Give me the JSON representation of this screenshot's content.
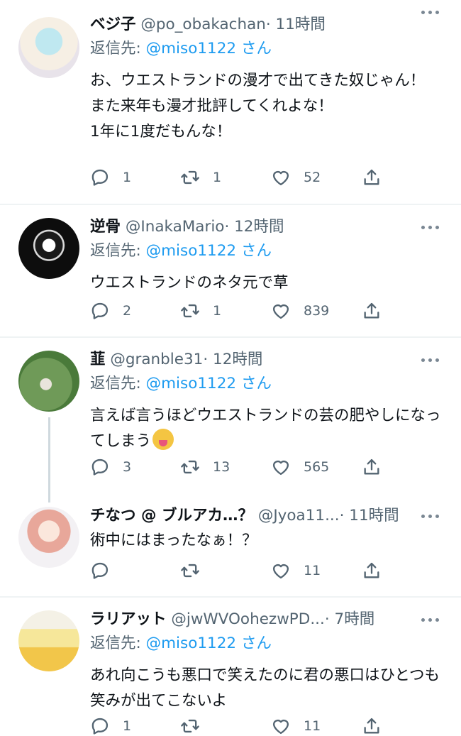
{
  "tweets": [
    {
      "name": "ベジ子",
      "handle": "@po_obakachan",
      "time": "· 11時間",
      "reply_prefix": "返信先:",
      "reply_to": "@miso1122",
      "reply_suffix": "さん",
      "text": "お、ウエストランドの漫才で出てきた奴じゃん！\nまた来年も漫才批評してくれよな！\n1年に1度だもんな！",
      "replies": "1",
      "retweets": "1",
      "likes": "52"
    },
    {
      "name": "逆骨",
      "handle": "@InakaMario",
      "time": "· 12時間",
      "reply_prefix": "返信先:",
      "reply_to": "@miso1122",
      "reply_suffix": "さん",
      "text": "ウエストランドのネタ元で草",
      "replies": "2",
      "retweets": "1",
      "likes": "839"
    },
    {
      "name": "韮",
      "handle": "@granble31",
      "time": "· 12時間",
      "reply_prefix": "返信先:",
      "reply_to": "@miso1122",
      "reply_suffix": "さん",
      "text": "言えば言うほどウエストランドの芸の肥やしになってしまう",
      "emoji": "squinting-face-with-tongue",
      "replies": "3",
      "retweets": "13",
      "likes": "565"
    },
    {
      "name": "チなつ @ ブルアカ…？",
      "handle": "@Jyoa11...",
      "time": "· 11時間",
      "text": "術中にはまったなぁ！？",
      "replies": "",
      "retweets": "",
      "likes": "11"
    },
    {
      "name": "ラリアット",
      "handle": "@jwWVOohezwPD...",
      "time": "· 7時間",
      "reply_prefix": "返信先:",
      "reply_to": "@miso1122",
      "reply_suffix": "さん",
      "text": "あれ向こうも悪口で笑えたのに君の悪口はひとつも笑みが出てこないよ",
      "replies": "1",
      "retweets": "",
      "likes": "11"
    }
  ],
  "icons": {
    "reply": "reply-icon",
    "retweet": "retweet-icon",
    "like": "like-icon",
    "share": "share-icon",
    "more": "more-icon"
  },
  "colors": {
    "link": "#1d9bf0",
    "secondary": "#536471",
    "divider": "#eff3f4"
  }
}
